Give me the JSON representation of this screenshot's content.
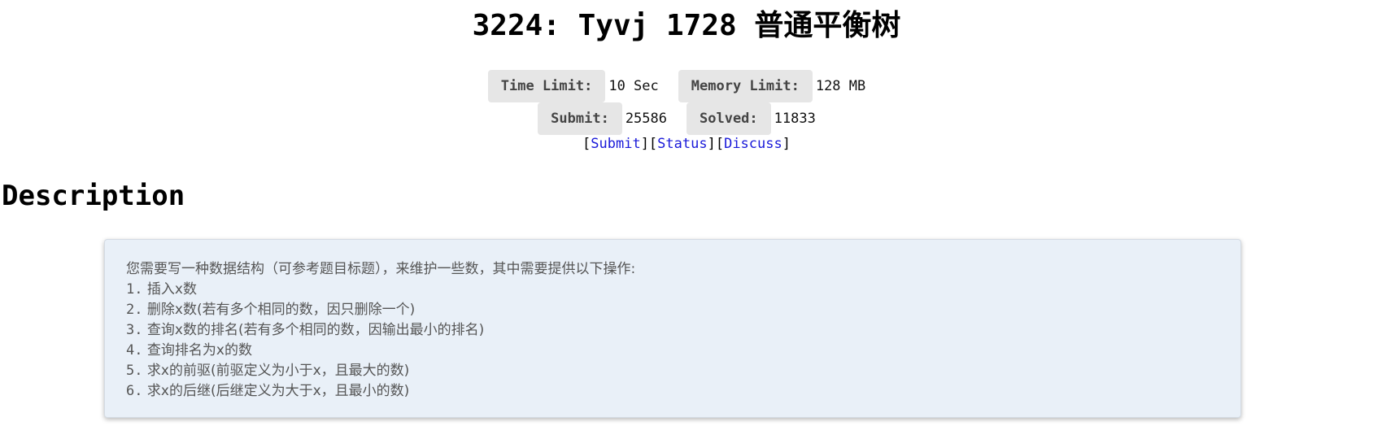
{
  "problem": {
    "title": "3224: Tyvj 1728 普通平衡树"
  },
  "limits": {
    "time_label": "Time Limit:",
    "time_value": "10 Sec",
    "memory_label": "Memory Limit:",
    "memory_value": "128 MB",
    "submit_label": "Submit:",
    "submit_value": "25586",
    "solved_label": "Solved:",
    "solved_value": "11833"
  },
  "links": {
    "submit": "Submit",
    "status": "Status",
    "discuss": "Discuss"
  },
  "description": {
    "heading": "Description",
    "intro": "您需要写一种数据结构（可参考题目标题），来维护一些数，其中需要提供以下操作:",
    "items": [
      {
        "num": "1.",
        "text": "插入x数"
      },
      {
        "num": "2.",
        "text": "删除x数(若有多个相同的数，因只删除一个)"
      },
      {
        "num": "3.",
        "text": "查询x数的排名(若有多个相同的数，因输出最小的排名)"
      },
      {
        "num": "4.",
        "text": "查询排名为x的数"
      },
      {
        "num": "5.",
        "text": "求x的前驱(前驱定义为小于x，且最大的数)"
      },
      {
        "num": "6.",
        "text": "求x的后继(后继定义为大于x，且最小的数)"
      }
    ]
  }
}
